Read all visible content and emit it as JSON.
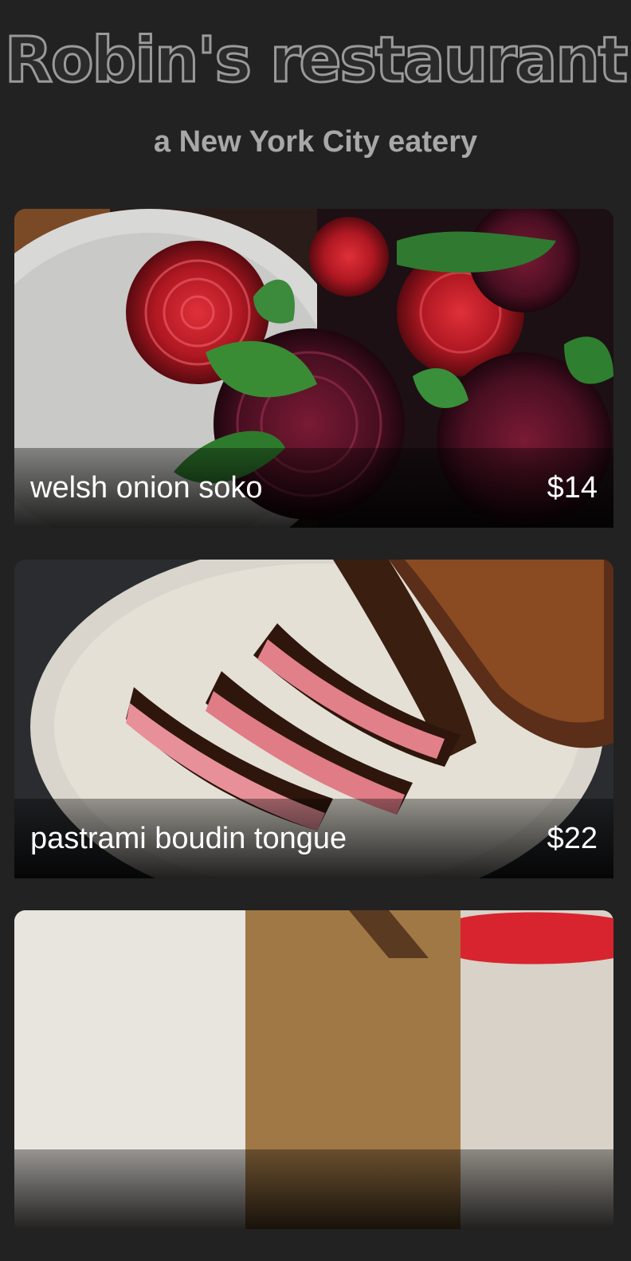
{
  "header": {
    "title": "Robin's restaurant",
    "tagline": "a New York City eatery"
  },
  "menu": {
    "items": [
      {
        "name": "welsh onion soko",
        "price": "$14"
      },
      {
        "name": "pastrami boudin tongue",
        "price": "$22"
      },
      {
        "name": "",
        "price": ""
      }
    ]
  },
  "colors": {
    "background": "#222222",
    "title_fill": "#2b2b2b",
    "title_outline": "#9a9a9a",
    "tagline": "#a8a8a8",
    "caption_text": "#ffffff"
  }
}
